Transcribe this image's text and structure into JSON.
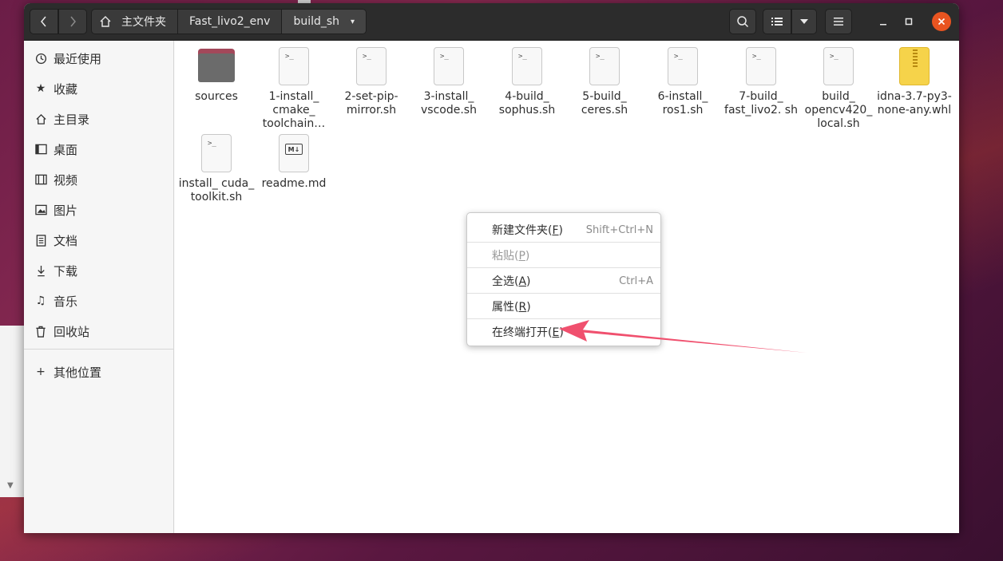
{
  "header": {
    "back_icon": "chevron-left-icon",
    "forward_icon": "chevron-right-icon",
    "breadcrumbs": [
      {
        "label": "主文件夹",
        "icon": "home-icon"
      },
      {
        "label": "Fast_livo2_env"
      },
      {
        "label": "build_sh",
        "caret": "▾"
      }
    ]
  },
  "sidebar": {
    "items": [
      {
        "label": "最近使用",
        "icon": "clock-icon"
      },
      {
        "label": "收藏",
        "icon": "star-icon"
      },
      {
        "label": "主目录",
        "icon": "home-icon"
      },
      {
        "label": "桌面",
        "icon": "desktop-icon"
      },
      {
        "label": "视频",
        "icon": "video-icon"
      },
      {
        "label": "图片",
        "icon": "image-icon"
      },
      {
        "label": "文档",
        "icon": "document-icon"
      },
      {
        "label": "下载",
        "icon": "download-icon"
      },
      {
        "label": "音乐",
        "icon": "music-icon"
      },
      {
        "label": "回收站",
        "icon": "trash-icon"
      }
    ],
    "other": {
      "label": "其他位置",
      "icon": "plus-icon"
    }
  },
  "files": [
    {
      "name": "sources",
      "kind": "folder"
    },
    {
      "name": "1-install_ cmake_ toolchain…",
      "kind": "script"
    },
    {
      "name": "2-set-pip-mirror.sh",
      "kind": "script"
    },
    {
      "name": "3-install_ vscode.sh",
      "kind": "script"
    },
    {
      "name": "4-build_ sophus.sh",
      "kind": "script"
    },
    {
      "name": "5-build_ ceres.sh",
      "kind": "script"
    },
    {
      "name": "6-install_ ros1.sh",
      "kind": "script"
    },
    {
      "name": "7-build_ fast_livo2. sh",
      "kind": "script"
    },
    {
      "name": "build_ opencv420_ local.sh",
      "kind": "script"
    },
    {
      "name": "idna-3.7-py3-none-any.whl",
      "kind": "archive"
    },
    {
      "name": "install_ cuda_ toolkit.sh",
      "kind": "script"
    },
    {
      "name": "readme.md",
      "kind": "markdown"
    }
  ],
  "script_prompt": ">_",
  "markdown_badge": "M↓",
  "context_menu": {
    "items": [
      {
        "label": "新建文件夹(F)",
        "mnemonic": "F",
        "shortcut": "Shift+Ctrl+N",
        "enabled": true
      },
      {
        "label": "粘贴(P)",
        "mnemonic": "P",
        "shortcut": "",
        "enabled": false
      },
      {
        "label": "全选(A)",
        "mnemonic": "A",
        "shortcut": "Ctrl+A",
        "enabled": true
      },
      {
        "label": "属性(R)",
        "mnemonic": "R",
        "shortcut": "",
        "enabled": true
      },
      {
        "label": "在终端打开(E)",
        "mnemonic": "E",
        "shortcut": "",
        "enabled": true
      }
    ]
  },
  "colors": {
    "accent": "#e95420",
    "annotation_arrow": "#f0506e",
    "headerbar": "#2c2c2c",
    "folder": "#6b6b6b",
    "folder_tab": "#a3485a",
    "archive": "#f6d34a"
  }
}
